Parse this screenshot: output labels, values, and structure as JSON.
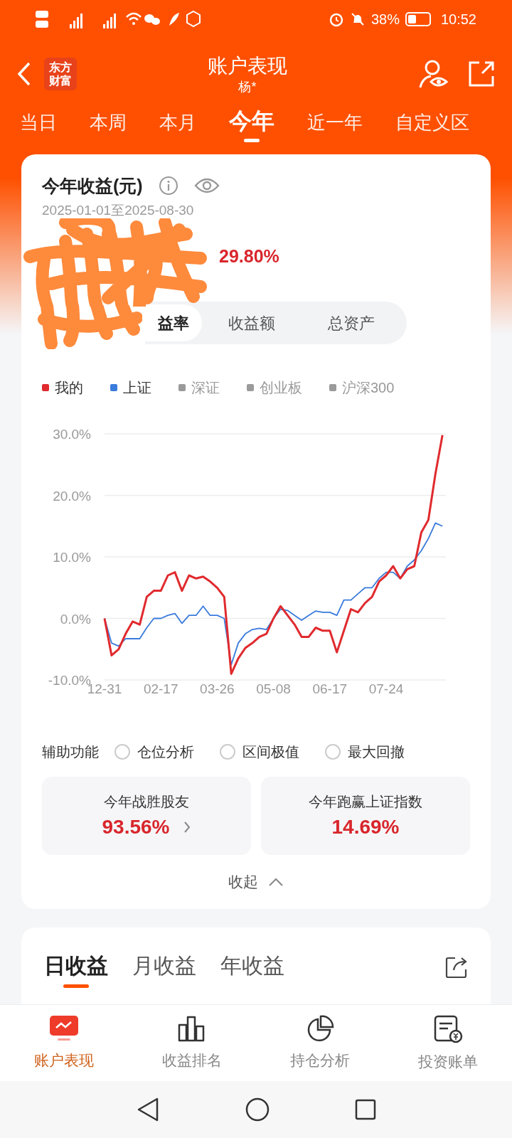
{
  "status_bar": {
    "battery": "38%",
    "time": "10:52"
  },
  "header": {
    "logo_lines": [
      "东方",
      "财富"
    ],
    "title": "账户表现",
    "subtitle": "杨*"
  },
  "period_tabs": [
    {
      "label": "当日",
      "selected": false
    },
    {
      "label": "本周",
      "selected": false
    },
    {
      "label": "本月",
      "selected": false
    },
    {
      "label": "今年",
      "selected": true
    },
    {
      "label": "近一年",
      "selected": false
    },
    {
      "label": "自定义区",
      "selected": false
    }
  ],
  "summary": {
    "title": "今年收益(元)",
    "date_range": "2025-01-01至2025-08-30",
    "return_pct": "29.80%",
    "segments": [
      {
        "label": "益率",
        "selected": true
      },
      {
        "label": "收益额",
        "selected": false
      },
      {
        "label": "总资产",
        "selected": false
      }
    ],
    "legend": [
      {
        "label": "深证",
        "color": "#9a9a9a",
        "selected": false
      },
      {
        "label": "创业板",
        "color": "#9a9a9a",
        "selected": false
      },
      {
        "label": "沪深300",
        "color": "#9a9a9a",
        "selected": false
      }
    ],
    "chart_data": {
      "type": "line",
      "grid": true,
      "categories": [
        "12-31",
        null,
        null,
        null,
        null,
        null,
        null,
        null,
        "02-17",
        null,
        null,
        null,
        null,
        null,
        null,
        null,
        "03-26",
        null,
        null,
        null,
        null,
        null,
        null,
        null,
        "05-08",
        null,
        null,
        null,
        null,
        null,
        null,
        null,
        "06-17",
        null,
        null,
        null,
        null,
        null,
        null,
        null,
        "07-24",
        null,
        null,
        null,
        null,
        null,
        null,
        null,
        null
      ],
      "ylim": [
        -10,
        30
      ],
      "yticks": [
        {
          "value": 30,
          "label": "30.0%"
        },
        {
          "value": 20,
          "label": "20.0%"
        },
        {
          "value": 10,
          "label": "10.0%"
        },
        {
          "value": 0,
          "label": "0.0%"
        },
        {
          "value": -10,
          "label": "-10.0%"
        }
      ],
      "series": [
        {
          "name": "我的",
          "color": "#e02a2e",
          "values": [
            0,
            -6,
            -5,
            -2.5,
            -0.5,
            -1,
            3.5,
            4.5,
            4.5,
            7,
            7.5,
            4.5,
            7,
            6.5,
            6.8,
            6,
            5,
            3.5,
            -9,
            -6.5,
            -4.8,
            -4,
            -3,
            -2.5,
            0,
            2,
            0.5,
            -1,
            -3,
            -3,
            -1.5,
            -2,
            -2,
            -5.5,
            -2,
            1.5,
            1,
            2.5,
            3.5,
            6,
            7,
            8.5,
            6.5,
            8,
            8.5,
            14,
            16,
            23.5,
            29.8
          ]
        },
        {
          "name": "上证",
          "color": "#3a7bdc",
          "values": [
            0,
            -4,
            -4.5,
            -3.3,
            -3.3,
            -3.3,
            -1.5,
            0,
            0,
            0.5,
            0.8,
            -0.8,
            0.5,
            0.5,
            2,
            0.5,
            0.5,
            0,
            -7.5,
            -4,
            -2.5,
            -1.8,
            -1.6,
            -1.8,
            0,
            1.5,
            1.3,
            0.5,
            -0.3,
            0.5,
            1.2,
            1,
            1,
            0.5,
            3,
            3,
            4,
            5,
            5,
            6.5,
            7.5,
            7.5,
            6.5,
            8.5,
            9.5,
            11,
            13,
            15.5,
            15
          ]
        }
      ]
    },
    "aux": {
      "label": "辅助功能",
      "options": [
        {
          "label": "仓位分析",
          "checked": false
        },
        {
          "label": "区间极值",
          "checked": false
        },
        {
          "label": "最大回撤",
          "checked": false
        }
      ]
    },
    "stats": [
      {
        "label": "今年战胜股友",
        "value": "93.56%",
        "link": true
      },
      {
        "label": "今年跑赢上证指数",
        "value": "14.69%",
        "link": false
      }
    ],
    "collapse": "收起"
  },
  "earnings_tabs": [
    {
      "label": "日收益",
      "selected": true
    },
    {
      "label": "月收益",
      "selected": false
    },
    {
      "label": "年收益",
      "selected": false
    }
  ],
  "bottom_nav": [
    {
      "label": "账户表现",
      "selected": true
    },
    {
      "label": "收益排名",
      "selected": false
    },
    {
      "label": "持仓分析",
      "selected": false
    },
    {
      "label": "投资账单",
      "selected": false
    }
  ]
}
